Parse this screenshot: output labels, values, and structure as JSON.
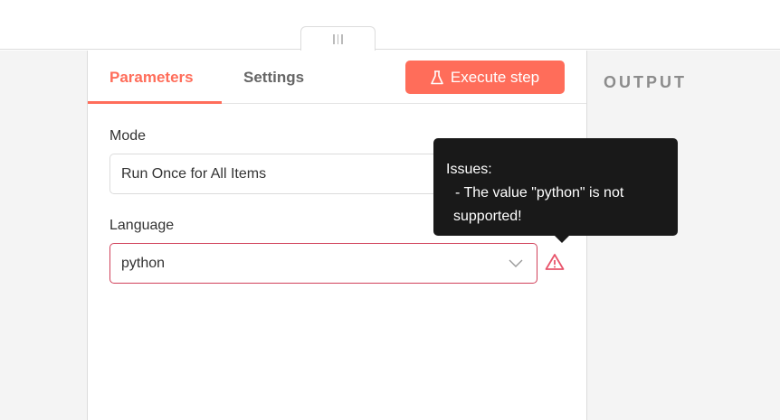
{
  "tabs": {
    "parameters": "Parameters",
    "settings": "Settings"
  },
  "execute_label": "Execute step",
  "output_label": "OUTPUT",
  "fields": {
    "mode": {
      "label": "Mode",
      "value": "Run Once for All Items"
    },
    "language": {
      "label": "Language",
      "value": "python"
    }
  },
  "tooltip": {
    "title": "Issues:",
    "line1": "- The value \"python\" is not",
    "line2": "supported!"
  },
  "colors": {
    "accent": "#ff6d5a",
    "error": "#d1415a"
  }
}
